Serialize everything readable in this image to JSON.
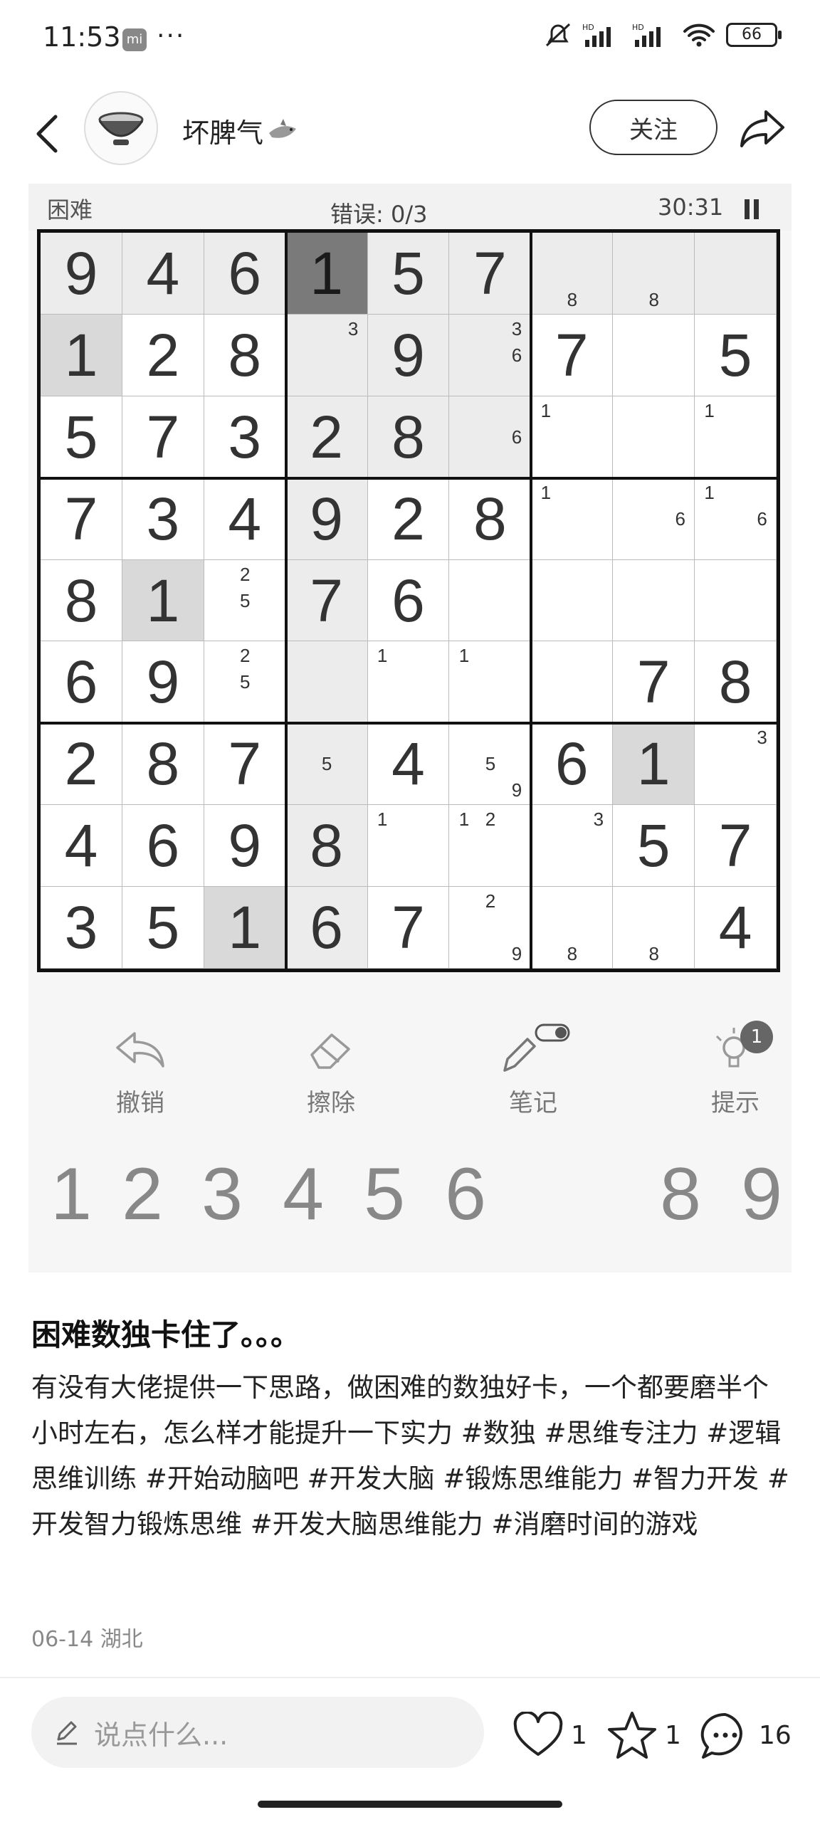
{
  "status_bar": {
    "time": "11:53",
    "mi_label": "mi",
    "more": "···",
    "battery": "66"
  },
  "header": {
    "username": "坏脾气",
    "follow_label": "关注"
  },
  "puzzle": {
    "level": "困难",
    "errors": "错误:  0/3",
    "timer": "30:31",
    "cells": [
      [
        "9",
        "4",
        "6",
        "1",
        "5",
        "7",
        "",
        "",
        ""
      ],
      [
        "1",
        "2",
        "8",
        "",
        "9",
        "",
        "7",
        "",
        "5"
      ],
      [
        "5",
        "7",
        "3",
        "2",
        "8",
        "",
        "",
        "",
        ""
      ],
      [
        "7",
        "3",
        "4",
        "9",
        "2",
        "8",
        "",
        "",
        ""
      ],
      [
        "8",
        "1",
        "",
        "7",
        "6",
        "",
        "",
        "",
        ""
      ],
      [
        "6",
        "9",
        "",
        "",
        "",
        "",
        "",
        "7",
        "8"
      ],
      [
        "2",
        "8",
        "7",
        "",
        "4",
        "",
        "6",
        "1",
        ""
      ],
      [
        "4",
        "6",
        "9",
        "8",
        "",
        "",
        "",
        "5",
        "7"
      ],
      [
        "3",
        "5",
        "1",
        "6",
        "7",
        "",
        "",
        "",
        "4"
      ]
    ],
    "notes": {
      "0-6": [
        "",
        "",
        "",
        "",
        "",
        "",
        "",
        "8",
        ""
      ],
      "0-7": [
        "",
        "",
        "",
        "",
        "",
        "",
        "",
        "8",
        ""
      ],
      "1-3": [
        "",
        "",
        "3",
        "",
        "",
        "",
        "",
        "",
        ""
      ],
      "1-5": [
        "",
        "",
        "3",
        "",
        "",
        "6",
        "",
        "",
        ""
      ],
      "2-5": [
        "",
        "",
        "",
        "",
        "",
        "6",
        "",
        "",
        ""
      ],
      "2-6": [
        "1",
        "",
        "",
        "",
        "",
        "",
        "",
        "",
        ""
      ],
      "2-8": [
        "1",
        "",
        "",
        "",
        "",
        "",
        "",
        "",
        ""
      ],
      "3-6": [
        "1",
        "",
        "",
        "",
        "",
        "",
        "",
        "",
        ""
      ],
      "3-7": [
        "",
        "",
        "",
        "",
        "",
        "6",
        "",
        "",
        ""
      ],
      "3-8": [
        "1",
        "",
        "",
        "",
        "",
        "6",
        "",
        "",
        ""
      ],
      "4-2": [
        "",
        "2",
        "",
        "",
        "5",
        "",
        "",
        "",
        ""
      ],
      "5-2": [
        "",
        "2",
        "",
        "",
        "5",
        "",
        "",
        "",
        ""
      ],
      "5-4": [
        "1",
        "",
        "",
        "",
        "",
        "",
        "",
        "",
        ""
      ],
      "5-5": [
        "1",
        "",
        "",
        "",
        "",
        "",
        "",
        "",
        ""
      ],
      "6-3": [
        "",
        "",
        "",
        "",
        "5",
        "",
        "",
        "",
        ""
      ],
      "6-5": [
        "",
        "",
        "",
        "",
        "5",
        "",
        "",
        "",
        "9"
      ],
      "6-8": [
        "",
        "",
        "3",
        "",
        "",
        "",
        "",
        "",
        ""
      ],
      "7-4": [
        "1",
        "",
        "",
        "",
        "",
        "",
        "",
        "",
        ""
      ],
      "7-5": [
        "1",
        "2",
        "",
        "",
        "",
        "",
        "",
        "",
        ""
      ],
      "7-6": [
        "",
        "",
        "3",
        "",
        "",
        "",
        "",
        "",
        ""
      ],
      "8-5": [
        "",
        "2",
        "",
        "",
        "",
        "",
        "",
        "",
        "9"
      ],
      "8-6": [
        "",
        "",
        "",
        "",
        "",
        "",
        "",
        "8",
        ""
      ],
      "8-7": [
        "",
        "",
        "",
        "",
        "",
        "",
        "",
        "8",
        ""
      ]
    },
    "highlight_dark": [
      "0-3"
    ],
    "highlight_mid": [
      "1-0",
      "4-1",
      "6-7",
      "8-2"
    ],
    "highlight_light": [
      "0-0",
      "0-1",
      "0-2",
      "0-4",
      "0-5",
      "0-6",
      "0-7",
      "0-8",
      "1-3",
      "1-4",
      "1-5",
      "2-3",
      "2-4",
      "2-5",
      "3-3",
      "4-3",
      "5-3",
      "6-3",
      "7-3",
      "8-3"
    ],
    "tools": [
      {
        "label": "撤销",
        "icon": "undo-icon"
      },
      {
        "label": "擦除",
        "icon": "eraser-icon"
      },
      {
        "label": "笔记",
        "icon": "pencil-icon"
      },
      {
        "label": "提示",
        "icon": "bulb-icon",
        "badge": "1"
      }
    ],
    "numbers": [
      "1",
      "2",
      "3",
      "4",
      "5",
      "6",
      "8",
      "9"
    ]
  },
  "post": {
    "title": "困难数独卡住了。。。",
    "body": "有没有大佬提供一下思路，做困难的数独好卡，一个都要磨半个小时左右，怎么样才能提升一下实力",
    "tags": "#数独 #思维专注力 #逻辑思维训练 #开始动脑吧 #开发大脑 #锻炼思维能力 #智力开发 #开发智力锻炼思维 #开发大脑思维能力 #消磨时间的游戏",
    "date": "06-14",
    "location": "湖北"
  },
  "bottom": {
    "comment_placeholder": "说点什么...",
    "likes": "1",
    "favorites": "1",
    "comments": "16"
  }
}
